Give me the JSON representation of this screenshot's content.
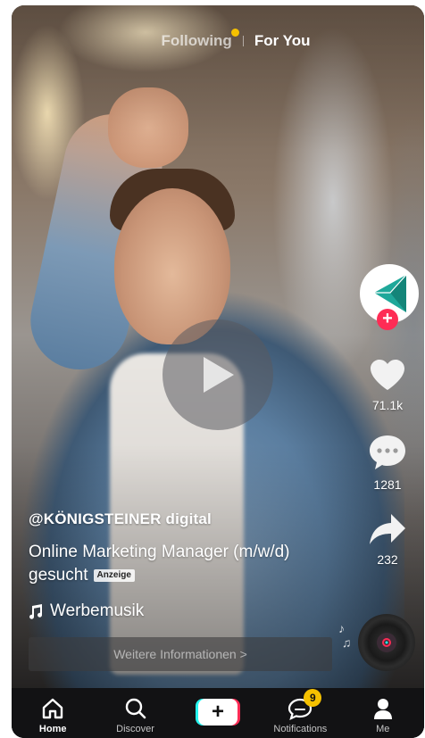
{
  "top_tabs": {
    "following": "Following",
    "for_you": "For You"
  },
  "video": {
    "play_icon": "play-icon"
  },
  "actions": {
    "avatar_icon": "brand-logo-icon",
    "likes": "71.1k",
    "comments": "1281",
    "shares": "232"
  },
  "post": {
    "username": "@KÖNIGSTEINER digital",
    "description": "Online Marketing Manager (m/w/d) gesucht",
    "ad_label": "Anzeige",
    "music": "Werbemusik",
    "cta": "Weitere Informationen >"
  },
  "nav": {
    "home": "Home",
    "discover": "Discover",
    "create": "+",
    "notifications": "Notifications",
    "notifications_badge": "9",
    "me": "Me"
  },
  "colors": {
    "accent": "#fe2c55",
    "badge": "#f5c100"
  }
}
